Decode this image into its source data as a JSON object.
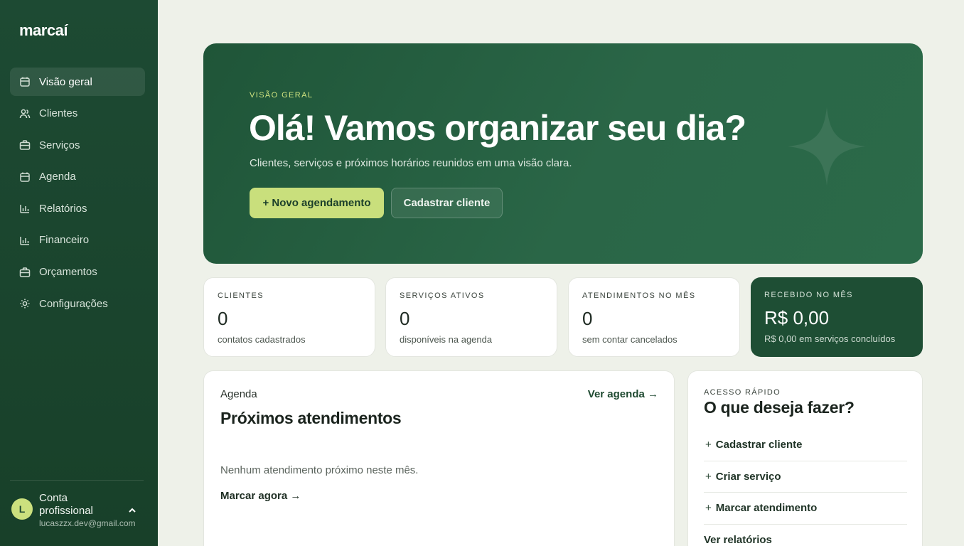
{
  "sidebar": {
    "logo": "marcaí",
    "items": [
      {
        "label": "Visão geral",
        "icon": "calendar-icon"
      },
      {
        "label": "Clientes",
        "icon": "users-icon"
      },
      {
        "label": "Serviços",
        "icon": "briefcase-icon"
      },
      {
        "label": "Agenda",
        "icon": "calendar-icon"
      },
      {
        "label": "Relatórios",
        "icon": "bar-chart-icon"
      },
      {
        "label": "Financeiro",
        "icon": "bar-chart-icon"
      },
      {
        "label": "Orçamentos",
        "icon": "briefcase-icon"
      },
      {
        "label": "Configurações",
        "icon": "gear-icon"
      }
    ],
    "account": {
      "initial": "L",
      "name": "Conta profissional",
      "email": "lucaszzx.dev@gmail.com"
    }
  },
  "hero": {
    "eyebrow": "VISÃO GERAL",
    "title": "Olá! Vamos organizar seu dia?",
    "subtitle": "Clientes, serviços e próximos horários reunidos em uma visão clara.",
    "primary_button": "+ Novo agendamento",
    "secondary_button": "Cadastrar cliente"
  },
  "stats": [
    {
      "label": "CLIENTES",
      "value": "0",
      "desc": "contatos cadastrados"
    },
    {
      "label": "SERVIÇOS ATIVOS",
      "value": "0",
      "desc": "disponíveis na agenda"
    },
    {
      "label": "ATENDIMENTOS NO MÊS",
      "value": "0",
      "desc": "sem contar cancelados"
    },
    {
      "label": "RECEBIDO NO MÊS",
      "value": "R$ 0,00",
      "desc": "R$ 0,00 em serviços concluídos"
    }
  ],
  "agenda": {
    "eyebrow": "Agenda",
    "link": "Ver agenda →",
    "title": "Próximos atendimentos",
    "empty": "Nenhum atendimento próximo neste mês.",
    "cta": "Marcar agora →"
  },
  "quick": {
    "eyebrow": "ACESSO RÁPIDO",
    "title": "O que deseja fazer?",
    "items": [
      {
        "plus": "+",
        "label": "Cadastrar cliente"
      },
      {
        "plus": "+",
        "label": "Criar serviço"
      },
      {
        "plus": "+",
        "label": "Marcar atendimento"
      },
      {
        "plus": "",
        "label": "Ver relatórios"
      }
    ]
  },
  "colors": {
    "sidebar": "#1d4a33",
    "hero": "#2a6647",
    "accent": "#c9df7c",
    "dark_card": "#1e4e34"
  }
}
